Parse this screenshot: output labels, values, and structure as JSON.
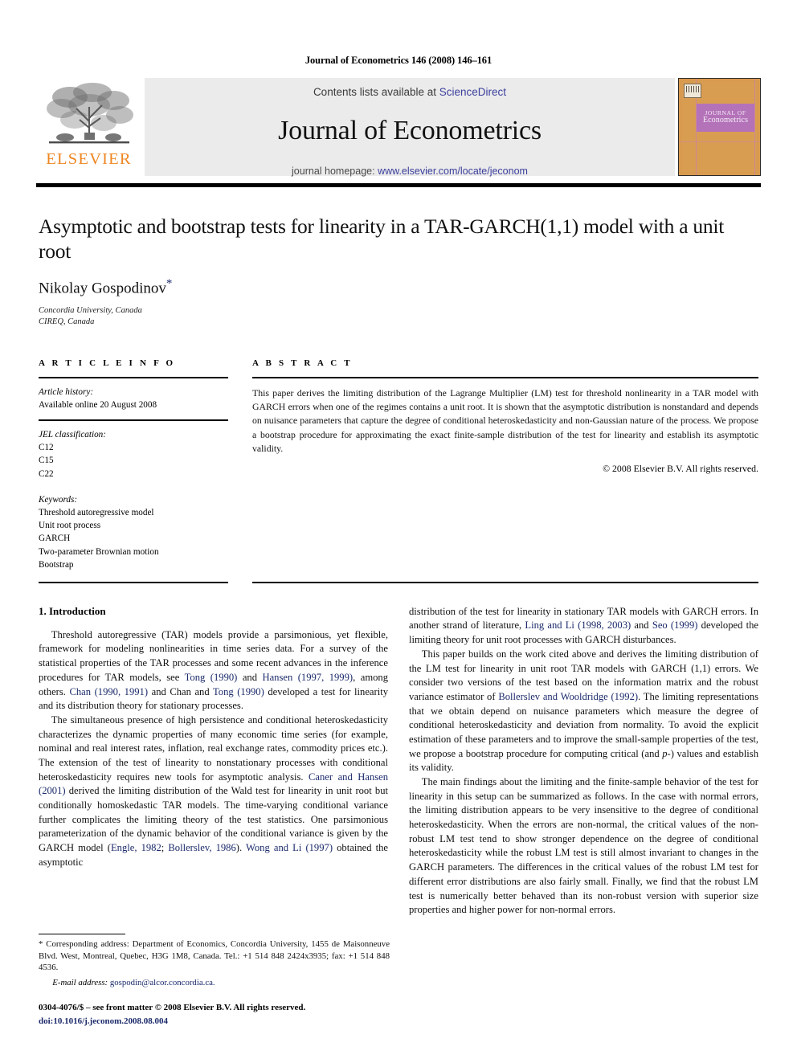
{
  "running_head": "Journal of Econometrics 146 (2008) 146–161",
  "masthead": {
    "publisher_name": "ELSEVIER",
    "contents_prefix": "Contents lists available at ",
    "contents_link": "ScienceDirect",
    "journal_name": "Journal of Econometrics",
    "homepage_prefix": "journal homepage: ",
    "homepage_link": "www.elsevier.com/locate/jeconom",
    "cover_title_line1": "JOURNAL OF",
    "cover_title_line2": "Econometrics",
    "link_color": "#3b3f9c",
    "brand_color": "#EE8622",
    "cover_bg": "#d99d52",
    "cover_band": "#b472b9"
  },
  "title_block": {
    "title": "Asymptotic and bootstrap tests for linearity in a TAR-GARCH(1,1) model with a unit root",
    "author": "Nikolay Gospodinov",
    "author_marker": "*",
    "affiliation_line1": "Concordia University, Canada",
    "affiliation_line2": "CIREQ, Canada"
  },
  "article_info": {
    "heading": "A R T I C L E   I N F O",
    "history_label": "Article history:",
    "history_value": "Available online 20 August 2008",
    "jel_label": "JEL classification:",
    "jel_codes": [
      "C12",
      "C15",
      "C22"
    ],
    "keywords_label": "Keywords:",
    "keywords": [
      "Threshold autoregressive model",
      "Unit root process",
      "GARCH",
      "Two-parameter Brownian motion",
      "Bootstrap"
    ]
  },
  "abstract": {
    "heading": "A B S T R A C T",
    "text": "This paper derives the limiting distribution of the Lagrange Multiplier (LM) test for threshold nonlinearity in a TAR model with GARCH errors when one of the regimes contains a unit root. It is shown that the asymptotic distribution is nonstandard and depends on nuisance parameters that capture the degree of conditional heteroskedasticity and non-Gaussian nature of the process. We propose a bootstrap procedure for approximating the exact finite-sample distribution of the test for linearity and establish its asymptotic validity.",
    "copyright": "© 2008 Elsevier B.V. All rights reserved."
  },
  "body": {
    "section_heading": "1. Introduction",
    "left_paragraph_1": "Threshold autoregressive (TAR) models provide a parsimonious, yet flexible, framework for modeling nonlinearities in time series data. For a survey of the statistical properties of the TAR processes and some recent advances in the inference procedures for TAR models, see Tong (1990) and Hansen (1997, 1999), among others. Chan (1990, 1991) and Chan and Tong (1990) developed a test for linearity and its distribution theory for stationary processes.",
    "left_paragraph_2": "The simultaneous presence of high persistence and conditional heteroskedasticity characterizes the dynamic properties of many economic time series (for example, nominal and real interest rates, inflation, real exchange rates, commodity prices etc.). The extension of the test of linearity to nonstationary processes with conditional heteroskedasticity requires new tools for asymptotic analysis. Caner and Hansen (2001) derived the limiting distribution of the Wald test for linearity in unit root but conditionally homoskedastic TAR models. The time-varying conditional variance further complicates the limiting theory of the test statistics. One parsimonious parameterization of the dynamic behavior of the conditional variance is given by the GARCH model (Engle, 1982; Bollerslev, 1986). Wong and Li (1997) obtained the asymptotic",
    "right_paragraph_1": "distribution of the test for linearity in stationary TAR models with GARCH errors. In another strand of literature, Ling and Li (1998, 2003) and Seo (1999) developed the limiting theory for unit root processes with GARCH disturbances.",
    "right_paragraph_2": "This paper builds on the work cited above and derives the limiting distribution of the LM test for linearity in unit root TAR models with GARCH (1,1) errors. We consider two versions of the test based on the information matrix and the robust variance estimator of Bollerslev and Wooldridge (1992). The limiting representations that we obtain depend on nuisance parameters which measure the degree of conditional heteroskedasticity and deviation from normality. To avoid the explicit estimation of these parameters and to improve the small-sample properties of the test, we propose a bootstrap procedure for computing critical (and p-) values and establish its validity.",
    "right_paragraph_3": "The main findings about the limiting and the finite-sample behavior of the  test for linearity in this setup can be summarized as follows. In the case with normal errors, the limiting distribution appears to be very insensitive to the degree of conditional heteroskedasticity. When the errors are non-normal, the critical values of the non-robust LM test tend to show stronger dependence on the degree of conditional heteroskedasticity while the robust LM test is still almost invariant to changes in the GARCH parameters. The differences in the critical values of the robust LM test for different error distributions are also fairly small. Finally, we find that the robust LM test is numerically better behaved than its non-robust version with superior size properties and higher power for non-normal errors.",
    "reference_color": "#1b2a6b"
  },
  "footer": {
    "footnote_marker": "*",
    "footnote_text": "Corresponding address: Department of Economics, Concordia University, 1455 de Maisonneuve Blvd. West, Montreal, Quebec, H3G 1M8, Canada. Tel.: +1 514 848 2424x3935; fax: +1 514 848 4536.",
    "email_label": "E-mail address:",
    "email_value": "gospodin@alcor.concordia.ca.",
    "issn_line": "0304-4076/$ – see front matter © 2008 Elsevier B.V. All rights reserved.",
    "doi_line": "doi:10.1016/j.jeconom.2008.08.004"
  }
}
